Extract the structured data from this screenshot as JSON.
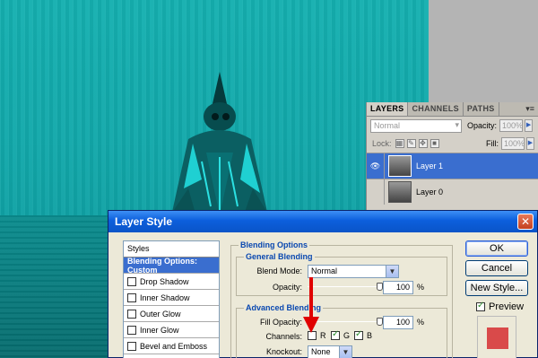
{
  "layers_panel": {
    "tabs": [
      "LAYERS",
      "CHANNELS",
      "PATHS"
    ],
    "blend_mode": "Normal",
    "opacity_label": "Opacity:",
    "opacity_value": "100%",
    "lock_label": "Lock:",
    "fill_label": "Fill:",
    "fill_value": "100%",
    "layers": [
      {
        "name": "Layer 1",
        "visible": true,
        "selected": true
      },
      {
        "name": "Layer 0",
        "visible": false,
        "selected": false
      }
    ]
  },
  "dialog": {
    "title": "Layer Style",
    "styles_header": "Styles",
    "style_items": [
      {
        "label": "Blending Options: Custom",
        "selected": true,
        "checkbox": false
      },
      {
        "label": "Drop Shadow",
        "selected": false,
        "checkbox": true
      },
      {
        "label": "Inner Shadow",
        "selected": false,
        "checkbox": true
      },
      {
        "label": "Outer Glow",
        "selected": false,
        "checkbox": true
      },
      {
        "label": "Inner Glow",
        "selected": false,
        "checkbox": true
      },
      {
        "label": "Bevel and Emboss",
        "selected": false,
        "checkbox": true
      }
    ],
    "blending_options": {
      "title": "Blending Options",
      "general_title": "General Blending",
      "blend_mode_label": "Blend Mode:",
      "blend_mode_value": "Normal",
      "opacity_label": "Opacity:",
      "opacity_value": "100",
      "pct": "%",
      "advanced_title": "Advanced Blending",
      "fill_opacity_label": "Fill Opacity:",
      "fill_opacity_value": "100",
      "channels_label": "Channels:",
      "channels": [
        {
          "label": "R",
          "checked": false
        },
        {
          "label": "G",
          "checked": true
        },
        {
          "label": "B",
          "checked": true
        }
      ],
      "knockout_label": "Knockout:",
      "knockout_value": "None"
    },
    "buttons": {
      "ok": "OK",
      "cancel": "Cancel",
      "new_style": "New Style..."
    },
    "preview_label": "Preview",
    "preview_checked": true,
    "preview_color": "#d94a4a"
  }
}
